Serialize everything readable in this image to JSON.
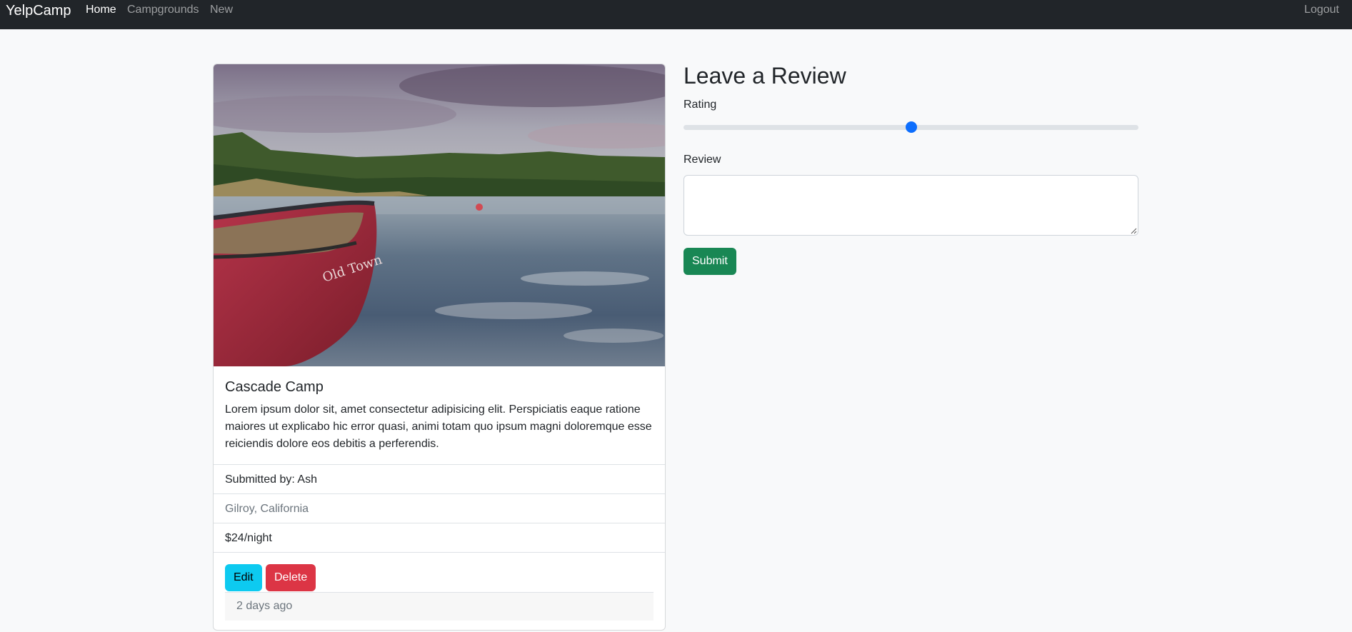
{
  "nav": {
    "brand": "YelpCamp",
    "links": [
      "Home",
      "Campgrounds",
      "New"
    ],
    "logout": "Logout"
  },
  "campground": {
    "title": "Cascade Camp",
    "description": "Lorem ipsum dolor sit, amet consectetur adipisicing elit. Perspiciatis eaque ratione maiores ut explicabo hic error quasi, animi totam quo ipsum magni doloremque esse reiciendis dolore eos debitis a perferendis.",
    "submitted_by": "Submitted by: Ash",
    "location": "Gilroy, California",
    "price": "$24/night",
    "edit_label": "Edit",
    "delete_label": "Delete",
    "footer": "2 days ago"
  },
  "review_form": {
    "title": "Leave a Review",
    "rating_label": "Rating",
    "rating_fraction": 0.5,
    "review_label": "Review",
    "review_value": "",
    "submit_label": "Submit"
  },
  "colors": {
    "navbar": "#212529",
    "primary": "#0d6efd",
    "info": "#0dcaf0",
    "danger": "#dc3545",
    "success": "#198754"
  }
}
